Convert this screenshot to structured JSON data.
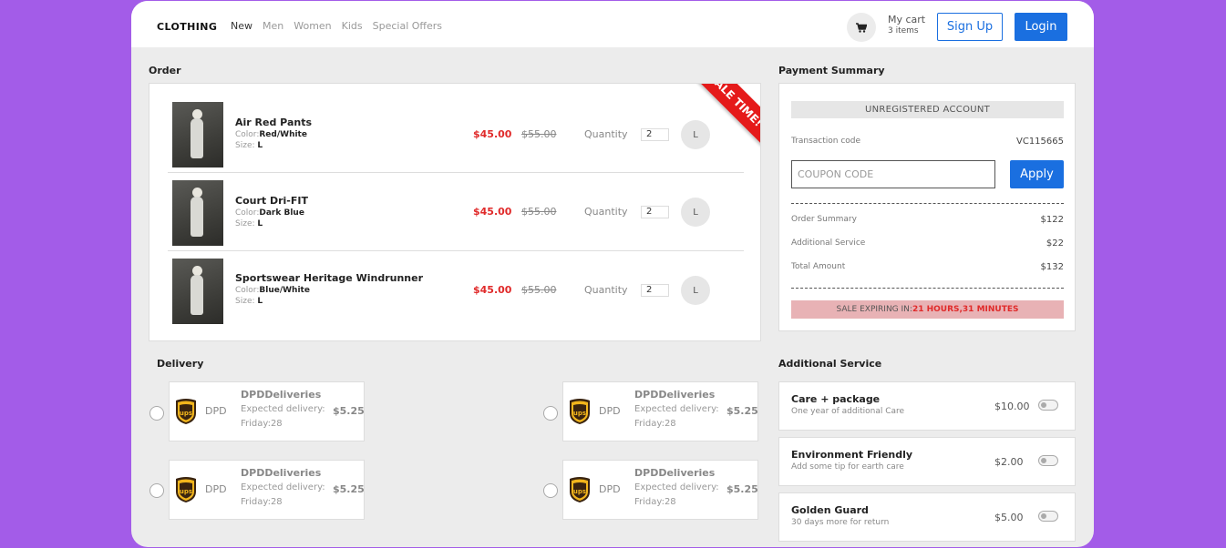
{
  "header": {
    "brand": "CLOTHING",
    "nav": [
      "New",
      "Men",
      "Women",
      "Kids",
      "Special Offers"
    ],
    "cart_label": "My cart",
    "cart_count": "3 items",
    "signup_label": "Sign Up",
    "login_label": "Login"
  },
  "order": {
    "title": "Order",
    "ribbon": "SALE TIME!",
    "items": [
      {
        "name": "Air Red Pants",
        "color_label": "Color:",
        "color": "Red/White",
        "size_label": "Size:",
        "size": "L",
        "price": "$45.00",
        "old_price": "$55.00",
        "qty_label": "Quantity",
        "qty": "2",
        "size_badge": "L"
      },
      {
        "name": "Court Dri-FIT",
        "color_label": "Color:",
        "color": "Dark Blue",
        "size_label": "Size:",
        "size": "L",
        "price": "$45.00",
        "old_price": "$55.00",
        "qty_label": "Quantity",
        "qty": "2",
        "size_badge": "L"
      },
      {
        "name": "Sportswear Heritage Windrunner",
        "color_label": "Color:",
        "color": "Blue/White",
        "size_label": "Size:",
        "size": "L",
        "price": "$45.00",
        "old_price": "$55.00",
        "qty_label": "Quantity",
        "qty": "2",
        "size_badge": "L"
      }
    ]
  },
  "payment": {
    "title": "Payment Summary",
    "account": "UNREGISTERED ACCOUNT",
    "transaction_label": "Transaction code",
    "transaction_code": "VC115665",
    "coupon_placeholder": "COUPON CODE",
    "apply_label": "Apply",
    "order_summary_label": "Order Summary",
    "order_summary": "$122",
    "additional_label": "Additional Service",
    "additional": "$22",
    "total_label": "Total Amount",
    "total": "$132",
    "sale_prefix": "SALE EXPIRING IN:",
    "sale_time": "21 HOURS,31 MINUTES"
  },
  "delivery": {
    "title": "Delivery",
    "options": [
      {
        "carrier": "DPD",
        "name": "DPDDeliveries",
        "desc1": "Expected delivery:",
        "desc2": "Friday:28",
        "price": "$5.25"
      },
      {
        "carrier": "DPD",
        "name": "DPDDeliveries",
        "desc1": "Expected delivery:",
        "desc2": "Friday:28",
        "price": "$5.25"
      },
      {
        "carrier": "DPD",
        "name": "DPDDeliveries",
        "desc1": "Expected delivery:",
        "desc2": "Friday:28",
        "price": "$5.25"
      },
      {
        "carrier": "DPD",
        "name": "DPDDeliveries",
        "desc1": "Expected delivery:",
        "desc2": "Friday:28",
        "price": "$5.25"
      }
    ]
  },
  "services": {
    "title": "Additional Service",
    "items": [
      {
        "name": "Care + package",
        "desc": "One year of additional Care",
        "price": "$10.00"
      },
      {
        "name": "Environment Friendly",
        "desc": "Add some tip for earth care",
        "price": "$2.00"
      },
      {
        "name": "Golden Guard",
        "desc": "30 days more for return",
        "price": "$5.00"
      }
    ]
  },
  "colors": {
    "background": "#a35ce8",
    "primary": "#1a6fe0",
    "sale_red": "#e02a2a",
    "ribbon": "#e51a1a",
    "sale_bar": "#e8b2b5"
  },
  "icons": [
    "cart-icon",
    "ups-logo-icon",
    "toggle-icon"
  ]
}
